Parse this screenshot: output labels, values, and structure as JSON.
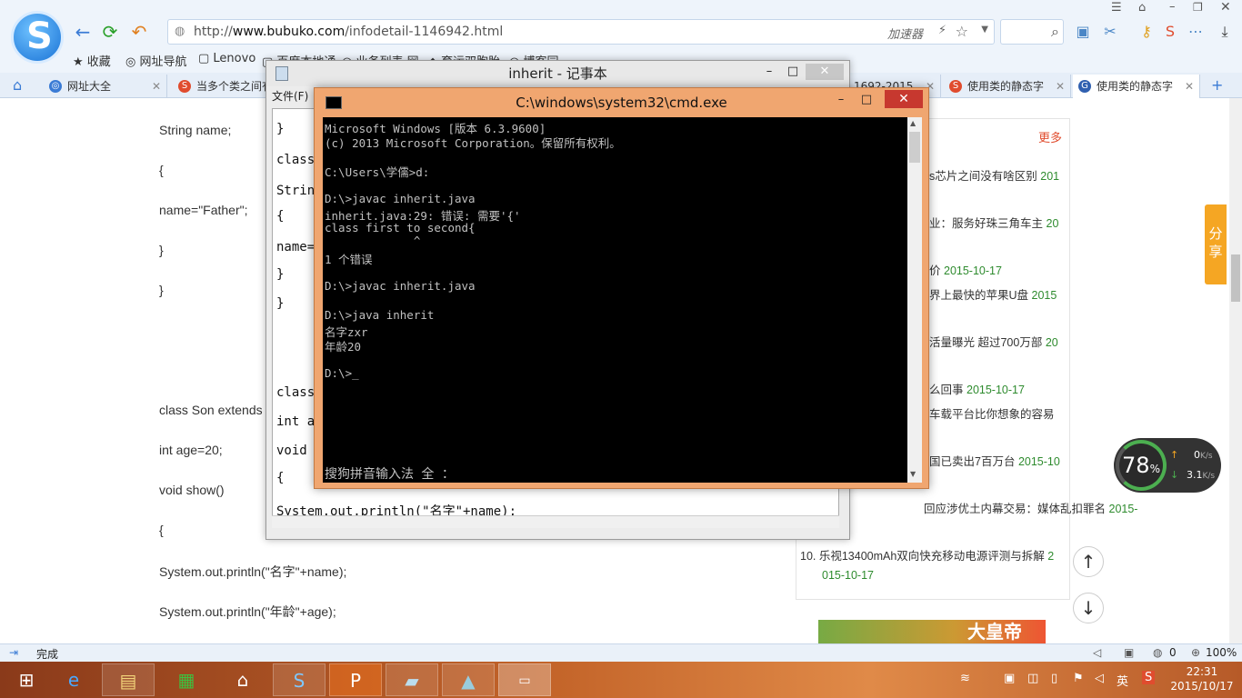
{
  "browser": {
    "url_prefix": "http://",
    "url_host": "www.bubuko.com",
    "url_path": "/infodetail-1146942.html",
    "accelerator_label": "加速器",
    "bookmarks": [
      "收藏",
      "网址导航",
      "Lenovo",
      "百度本地通",
      "业务列表 网",
      "育运双胞胎",
      "博客园"
    ],
    "tabs": [
      {
        "label": "网址大全"
      },
      {
        "label": "当多个类之间有"
      },
      {
        "label": "1692-2015"
      },
      {
        "label": "使用类的静态字"
      },
      {
        "label": "使用类的静态字"
      }
    ],
    "status": "完成",
    "status_count": "0",
    "zoom": "100%"
  },
  "page": {
    "code_lines": [
      "String name;",
      "{",
      "name=\"Father\";",
      "}",
      "}",
      "class Son extends",
      "int age=20;",
      "void show()",
      "{",
      "System.out.println(\"名字\"+name);",
      "System.out.println(\"年龄\"+age);"
    ],
    "side_more": "更多",
    "side_items": [
      {
        "text": "s芯片之间没有啥区别",
        "date": "201"
      },
      {
        "text": "业：服务好珠三角车主",
        "date": "20"
      },
      {
        "text": "价",
        "date": "2015-10-17"
      },
      {
        "text": "界上最快的苹果U盘",
        "date": "2015"
      },
      {
        "text": "活量曝光 超过700万部",
        "date": "20"
      },
      {
        "text": "么回事",
        "date": "2015-10-17"
      },
      {
        "text": "车载平台比你想象的容易",
        "date": ""
      },
      {
        "text": "国已卖出7百万台",
        "date": "2015-10"
      },
      {
        "text": "回应涉优土内幕交易：媒体乱扣罪名",
        "date": "2015-"
      },
      {
        "text": "10. 乐视13400mAh双向快充移动电源评测与拆解",
        "date": "2"
      },
      {
        "text": "",
        "date": "015-10-17"
      }
    ],
    "share_label": "分享",
    "ad_text": "大皇帝"
  },
  "speed_widget": {
    "percent": "78",
    "percent_unit": "%",
    "up": "0",
    "up_unit": "K/s",
    "down": "3.1",
    "down_unit": "K/s"
  },
  "notepad": {
    "title": "inherit - 记事本",
    "menu": "文件(F)",
    "lines": [
      "}",
      "class",
      "String",
      "{",
      "name=\"",
      "}",
      "}",
      "class",
      "int ag",
      "void s",
      "{",
      "System.out.println(\"名字\"+name);"
    ]
  },
  "cmd": {
    "title": "C:\\windows\\system32\\cmd.exe",
    "lines": [
      "Microsoft Windows [版本 6.3.9600]",
      "(c) 2013 Microsoft Corporation。保留所有权利。",
      "",
      "C:\\Users\\学儒>d:",
      "",
      "D:\\>javac inherit.java",
      "inherit.java:29: 错误: 需要'{'",
      "class first to second{",
      "             ^",
      "1 个错误",
      "",
      "D:\\>javac inherit.java",
      "",
      "D:\\>java inherit",
      "名字zxr",
      "年龄20",
      "",
      "D:\\>_"
    ],
    "ime": "搜狗拼音输入法 全 ："
  },
  "taskbar": {
    "time": "22:31",
    "date": "2015/10/17",
    "ime_label": "英"
  },
  "colors": {
    "accent": "#3a7bd5",
    "cmd_frame": "#f0a670",
    "taskbar": "#c4652a",
    "date_green": "#2e8b2e"
  }
}
